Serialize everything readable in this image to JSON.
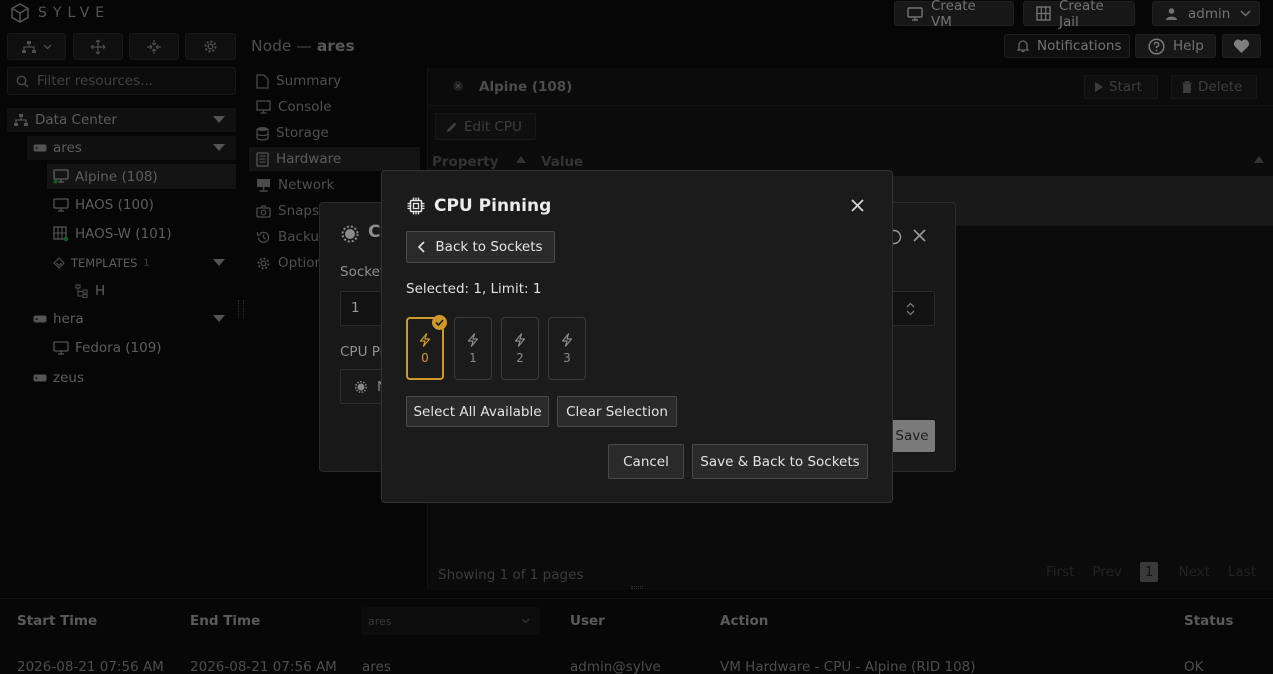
{
  "app": {
    "name": "SYLVE"
  },
  "topbar": {
    "create_vm": "Create VM",
    "create_jail": "Create Jail",
    "user": "admin",
    "notifications": "Notifications",
    "help": "Help"
  },
  "breadcrumb": {
    "prefix": "Node —",
    "node": "ares"
  },
  "sidebar": {
    "filter_placeholder": "Filter resources...",
    "tree": {
      "datacenter": "Data Center",
      "ares": "ares",
      "alpine": "Alpine (108)",
      "haos": "HAOS (100)",
      "haosw": "HAOS-W (101)",
      "templates": "TEMPLATES",
      "templates_count": "1",
      "template_h": "H",
      "hera": "hera",
      "fedora": "Fedora (109)",
      "zeus": "zeus"
    }
  },
  "node_nav": [
    "Summary",
    "Console",
    "Storage",
    "Hardware",
    "Network",
    "Snapsh",
    "Backup",
    "Option"
  ],
  "vm_panel": {
    "title": "Alpine (108)",
    "start": "Start",
    "delete": "Delete",
    "edit_cpu": "Edit CPU",
    "col_property": "Property",
    "col_value": "Value",
    "pagination_text": "Showing 1 of 1 pages",
    "first": "First",
    "prev": "Prev",
    "page": "1",
    "next": "Next",
    "last": "Last"
  },
  "back_dialog": {
    "title_partial": "C",
    "sockets_label": "Socket",
    "sockets_value": "1",
    "cpu_pinning_label": "CPU Pi",
    "pin_button_partial": "N",
    "save": "Save"
  },
  "dialog": {
    "title": "CPU Pinning",
    "back_button": "Back to Sockets",
    "selection_info": "Selected: 1, Limit: 1",
    "cores": [
      {
        "id": "0",
        "selected": true
      },
      {
        "id": "1",
        "selected": false
      },
      {
        "id": "2",
        "selected": false
      },
      {
        "id": "3",
        "selected": false
      }
    ],
    "select_all": "Select All Available",
    "clear_selection": "Clear Selection",
    "cancel": "Cancel",
    "save_back": "Save & Back to Sockets"
  },
  "audit_table": {
    "headers": {
      "start": "Start Time",
      "end": "End Time",
      "node_filter": "ares",
      "user": "User",
      "action": "Action",
      "status": "Status"
    },
    "row": {
      "start": "2026-08-21 07:56 AM",
      "end": "2026-08-21 07:56 AM",
      "node": "ares",
      "user": "admin@sylve",
      "action": "VM Hardware - CPU - Alpine (RID 108)",
      "status": "OK"
    }
  },
  "colors": {
    "accent": "#d09a2a",
    "background": "#0b0b0b",
    "dialog": "#1b1b1b"
  }
}
